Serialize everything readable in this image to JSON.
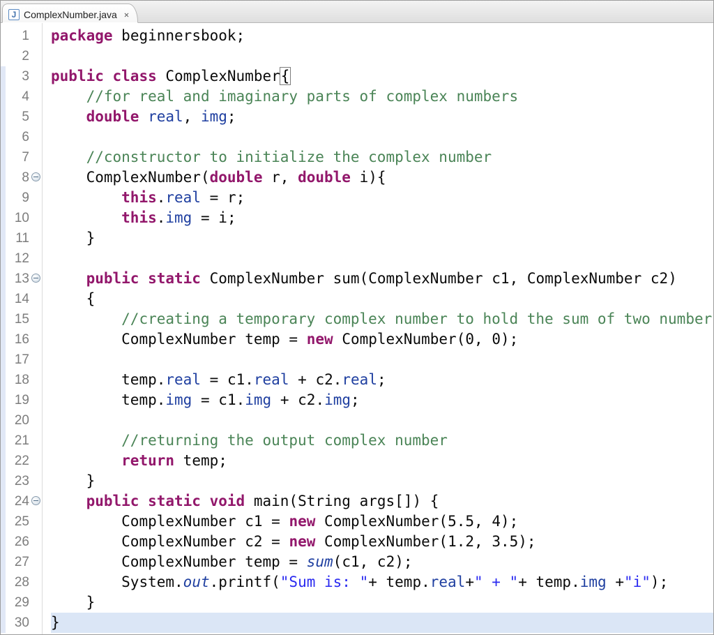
{
  "tab": {
    "icon_letter": "J",
    "filename": "ComplexNumber.java",
    "close_glyph": "✕"
  },
  "blue_strip_ranges": [
    [
      3,
      30
    ]
  ],
  "fold_lines": [
    8,
    13,
    24
  ],
  "highlighted_line": 30,
  "lines": [
    {
      "n": 1,
      "tokens": [
        [
          "kw",
          "package"
        ],
        [
          "",
          " "
        ],
        [
          "id",
          "beginnersbook"
        ],
        [
          "punc",
          ";"
        ]
      ]
    },
    {
      "n": 2,
      "tokens": []
    },
    {
      "n": 3,
      "tokens": [
        [
          "kw",
          "public"
        ],
        [
          "",
          " "
        ],
        [
          "kw",
          "class"
        ],
        [
          "",
          " "
        ],
        [
          "id",
          "ComplexNumber"
        ],
        [
          "brkt",
          "{"
        ]
      ]
    },
    {
      "n": 4,
      "tokens": [
        [
          "",
          "    "
        ],
        [
          "cmt",
          "//for real and imaginary parts of complex numbers"
        ]
      ]
    },
    {
      "n": 5,
      "tokens": [
        [
          "",
          "    "
        ],
        [
          "kw",
          "double"
        ],
        [
          "",
          " "
        ],
        [
          "fld",
          "real"
        ],
        [
          "punc",
          ", "
        ],
        [
          "fld",
          "img"
        ],
        [
          "punc",
          ";"
        ]
      ]
    },
    {
      "n": 6,
      "tokens": []
    },
    {
      "n": 7,
      "tokens": [
        [
          "",
          "    "
        ],
        [
          "cmt",
          "//constructor to initialize the complex number"
        ]
      ]
    },
    {
      "n": 8,
      "tokens": [
        [
          "",
          "    "
        ],
        [
          "id",
          "ComplexNumber"
        ],
        [
          "punc",
          "("
        ],
        [
          "kw",
          "double"
        ],
        [
          "",
          " "
        ],
        [
          "id",
          "r"
        ],
        [
          "punc",
          ", "
        ],
        [
          "kw",
          "double"
        ],
        [
          "",
          " "
        ],
        [
          "id",
          "i"
        ],
        [
          "punc",
          "){"
        ]
      ]
    },
    {
      "n": 9,
      "tokens": [
        [
          "",
          "        "
        ],
        [
          "kw",
          "this"
        ],
        [
          "punc",
          "."
        ],
        [
          "fld",
          "real"
        ],
        [
          "",
          " "
        ],
        [
          "punc",
          "="
        ],
        [
          "",
          " "
        ],
        [
          "id",
          "r"
        ],
        [
          "punc",
          ";"
        ]
      ]
    },
    {
      "n": 10,
      "tokens": [
        [
          "",
          "        "
        ],
        [
          "kw",
          "this"
        ],
        [
          "punc",
          "."
        ],
        [
          "fld",
          "img"
        ],
        [
          "",
          " "
        ],
        [
          "punc",
          "="
        ],
        [
          "",
          " "
        ],
        [
          "id",
          "i"
        ],
        [
          "punc",
          ";"
        ]
      ]
    },
    {
      "n": 11,
      "tokens": [
        [
          "",
          "    "
        ],
        [
          "punc",
          "}"
        ]
      ]
    },
    {
      "n": 12,
      "tokens": []
    },
    {
      "n": 13,
      "tokens": [
        [
          "",
          "    "
        ],
        [
          "kw",
          "public"
        ],
        [
          "",
          " "
        ],
        [
          "kw",
          "static"
        ],
        [
          "",
          " "
        ],
        [
          "id",
          "ComplexNumber"
        ],
        [
          "",
          " "
        ],
        [
          "id",
          "sum"
        ],
        [
          "punc",
          "("
        ],
        [
          "id",
          "ComplexNumber"
        ],
        [
          "",
          " "
        ],
        [
          "id",
          "c1"
        ],
        [
          "punc",
          ", "
        ],
        [
          "id",
          "ComplexNumber"
        ],
        [
          "",
          " "
        ],
        [
          "id",
          "c2"
        ],
        [
          "punc",
          ")"
        ]
      ]
    },
    {
      "n": 14,
      "tokens": [
        [
          "",
          "    "
        ],
        [
          "punc",
          "{"
        ]
      ]
    },
    {
      "n": 15,
      "tokens": [
        [
          "",
          "        "
        ],
        [
          "cmt",
          "//creating a temporary complex number to hold the sum of two numbers"
        ]
      ]
    },
    {
      "n": 16,
      "tokens": [
        [
          "",
          "        "
        ],
        [
          "id",
          "ComplexNumber"
        ],
        [
          "",
          " "
        ],
        [
          "id",
          "temp"
        ],
        [
          "",
          " "
        ],
        [
          "punc",
          "="
        ],
        [
          "",
          " "
        ],
        [
          "kw",
          "new"
        ],
        [
          "",
          " "
        ],
        [
          "id",
          "ComplexNumber"
        ],
        [
          "punc",
          "("
        ],
        [
          "num",
          "0"
        ],
        [
          "punc",
          ", "
        ],
        [
          "num",
          "0"
        ],
        [
          "punc",
          ");"
        ]
      ]
    },
    {
      "n": 17,
      "tokens": []
    },
    {
      "n": 18,
      "tokens": [
        [
          "",
          "        "
        ],
        [
          "id",
          "temp"
        ],
        [
          "punc",
          "."
        ],
        [
          "fld",
          "real"
        ],
        [
          "",
          " "
        ],
        [
          "punc",
          "="
        ],
        [
          "",
          " "
        ],
        [
          "id",
          "c1"
        ],
        [
          "punc",
          "."
        ],
        [
          "fld",
          "real"
        ],
        [
          "",
          " "
        ],
        [
          "punc",
          "+"
        ],
        [
          "",
          " "
        ],
        [
          "id",
          "c2"
        ],
        [
          "punc",
          "."
        ],
        [
          "fld",
          "real"
        ],
        [
          "punc",
          ";"
        ]
      ]
    },
    {
      "n": 19,
      "tokens": [
        [
          "",
          "        "
        ],
        [
          "id",
          "temp"
        ],
        [
          "punc",
          "."
        ],
        [
          "fld",
          "img"
        ],
        [
          "",
          " "
        ],
        [
          "punc",
          "="
        ],
        [
          "",
          " "
        ],
        [
          "id",
          "c1"
        ],
        [
          "punc",
          "."
        ],
        [
          "fld",
          "img"
        ],
        [
          "",
          " "
        ],
        [
          "punc",
          "+"
        ],
        [
          "",
          " "
        ],
        [
          "id",
          "c2"
        ],
        [
          "punc",
          "."
        ],
        [
          "fld",
          "img"
        ],
        [
          "punc",
          ";"
        ]
      ]
    },
    {
      "n": 20,
      "tokens": []
    },
    {
      "n": 21,
      "tokens": [
        [
          "",
          "        "
        ],
        [
          "cmt",
          "//returning the output complex number"
        ]
      ]
    },
    {
      "n": 22,
      "tokens": [
        [
          "",
          "        "
        ],
        [
          "kw",
          "return"
        ],
        [
          "",
          " "
        ],
        [
          "id",
          "temp"
        ],
        [
          "punc",
          ";"
        ]
      ]
    },
    {
      "n": 23,
      "tokens": [
        [
          "",
          "    "
        ],
        [
          "punc",
          "}"
        ]
      ]
    },
    {
      "n": 24,
      "tokens": [
        [
          "",
          "    "
        ],
        [
          "kw",
          "public"
        ],
        [
          "",
          " "
        ],
        [
          "kw",
          "static"
        ],
        [
          "",
          " "
        ],
        [
          "kwv",
          "void"
        ],
        [
          "",
          " "
        ],
        [
          "id",
          "main"
        ],
        [
          "punc",
          "("
        ],
        [
          "id",
          "String"
        ],
        [
          "",
          " "
        ],
        [
          "id",
          "args"
        ],
        [
          "punc",
          "[]) {"
        ]
      ]
    },
    {
      "n": 25,
      "tokens": [
        [
          "",
          "        "
        ],
        [
          "id",
          "ComplexNumber"
        ],
        [
          "",
          " "
        ],
        [
          "id",
          "c1"
        ],
        [
          "",
          " "
        ],
        [
          "punc",
          "="
        ],
        [
          "",
          " "
        ],
        [
          "kw",
          "new"
        ],
        [
          "",
          " "
        ],
        [
          "id",
          "ComplexNumber"
        ],
        [
          "punc",
          "("
        ],
        [
          "num",
          "5.5"
        ],
        [
          "punc",
          ", "
        ],
        [
          "num",
          "4"
        ],
        [
          "punc",
          ");"
        ]
      ]
    },
    {
      "n": 26,
      "tokens": [
        [
          "",
          "        "
        ],
        [
          "id",
          "ComplexNumber"
        ],
        [
          "",
          " "
        ],
        [
          "id",
          "c2"
        ],
        [
          "",
          " "
        ],
        [
          "punc",
          "="
        ],
        [
          "",
          " "
        ],
        [
          "kw",
          "new"
        ],
        [
          "",
          " "
        ],
        [
          "id",
          "ComplexNumber"
        ],
        [
          "punc",
          "("
        ],
        [
          "num",
          "1.2"
        ],
        [
          "punc",
          ", "
        ],
        [
          "num",
          "3.5"
        ],
        [
          "punc",
          ");"
        ]
      ]
    },
    {
      "n": 27,
      "tokens": [
        [
          "",
          "        "
        ],
        [
          "id",
          "ComplexNumber"
        ],
        [
          "",
          " "
        ],
        [
          "id",
          "temp"
        ],
        [
          "",
          " "
        ],
        [
          "punc",
          "="
        ],
        [
          "",
          " "
        ],
        [
          "static-it",
          "sum"
        ],
        [
          "punc",
          "("
        ],
        [
          "id",
          "c1"
        ],
        [
          "punc",
          ", "
        ],
        [
          "id",
          "c2"
        ],
        [
          "punc",
          ");"
        ]
      ]
    },
    {
      "n": 28,
      "tokens": [
        [
          "",
          "        "
        ],
        [
          "id",
          "System"
        ],
        [
          "punc",
          "."
        ],
        [
          "static-it",
          "out"
        ],
        [
          "punc",
          "."
        ],
        [
          "id",
          "printf"
        ],
        [
          "punc",
          "("
        ],
        [
          "str",
          "\"Sum is: \""
        ],
        [
          "punc",
          "+ "
        ],
        [
          "id",
          "temp"
        ],
        [
          "punc",
          "."
        ],
        [
          "fld",
          "real"
        ],
        [
          "punc",
          "+"
        ],
        [
          "str",
          "\" + \""
        ],
        [
          "punc",
          "+ "
        ],
        [
          "id",
          "temp"
        ],
        [
          "punc",
          "."
        ],
        [
          "fld",
          "img"
        ],
        [
          "",
          " "
        ],
        [
          "punc",
          "+"
        ],
        [
          "str",
          "\"i\""
        ],
        [
          "punc",
          ");"
        ]
      ]
    },
    {
      "n": 29,
      "tokens": [
        [
          "",
          "    "
        ],
        [
          "punc",
          "}"
        ]
      ]
    },
    {
      "n": 30,
      "tokens": [
        [
          "punc",
          "}"
        ]
      ]
    }
  ]
}
